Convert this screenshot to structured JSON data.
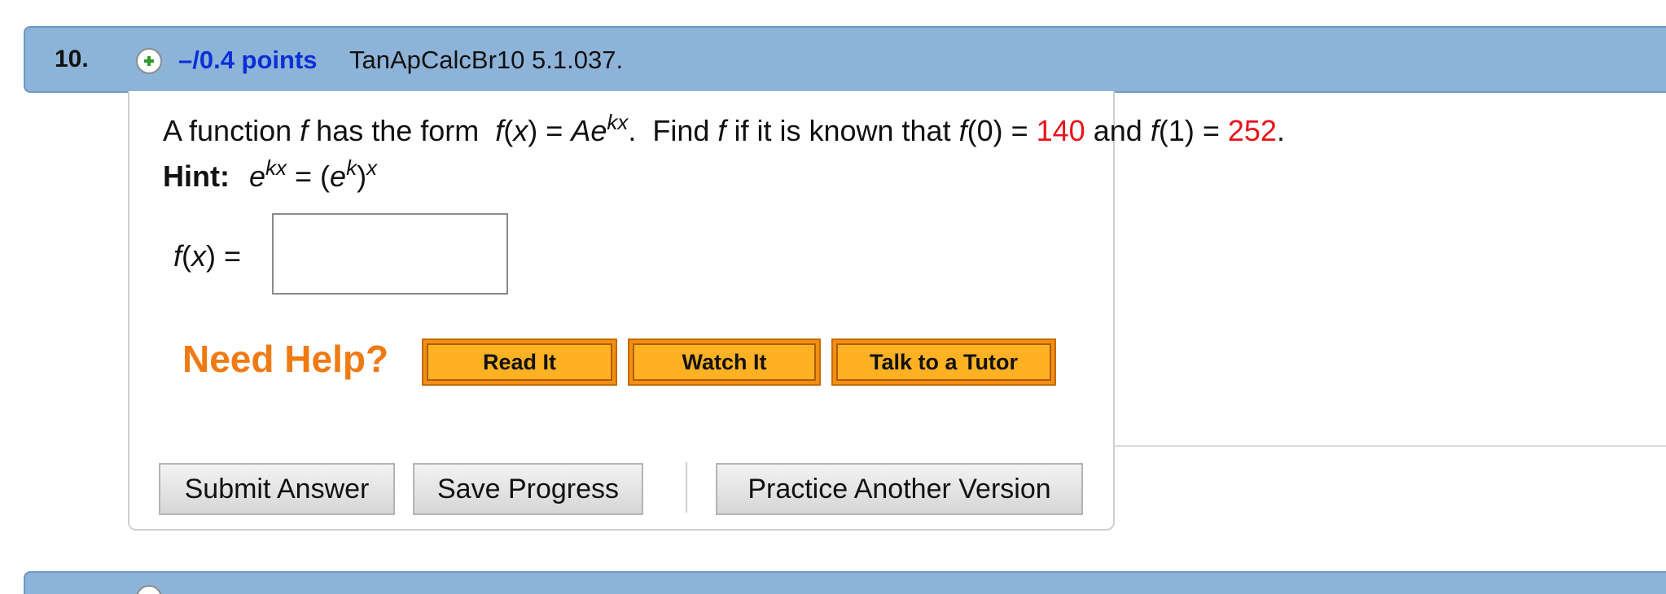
{
  "question": {
    "number": "10.",
    "points": "–/0.4 points",
    "id": "TanApCalcBr10 5.1.037.",
    "text_prefix": "A function",
    "text_has_form": "has the form",
    "text_find": "Find",
    "text_known": "if it is known that",
    "f0_value": "140",
    "text_and": "and",
    "f1_value": "252",
    "hint_label": "Hint:",
    "answer_label": "f(x) =",
    "answer_value": "",
    "answer_placeholder": ""
  },
  "help": {
    "label": "Need Help?",
    "buttons": [
      "Read It",
      "Watch It",
      "Talk to a Tutor"
    ]
  },
  "actions": {
    "submit": "Submit Answer",
    "save": "Save Progress",
    "practice": "Practice Another Version"
  },
  "colors": {
    "header_bg": "#8db4d8",
    "points_color": "#0a2fd6",
    "red_values": "#e8131b",
    "help_orange": "#f07a12",
    "button_orange": "#ffb124"
  },
  "icons": {
    "expand": "plus-circle-icon"
  }
}
